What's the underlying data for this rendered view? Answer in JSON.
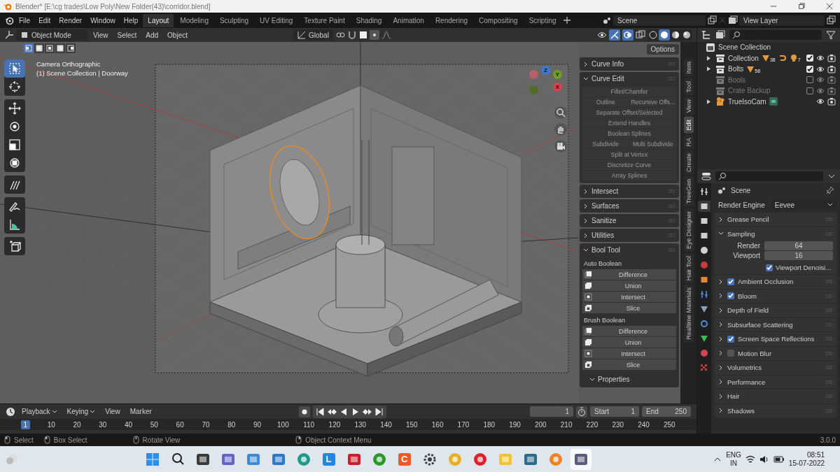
{
  "window": {
    "title": "Blender* [E:\\cg trades\\Low Poly\\New Folder(43)\\corridor.blend]"
  },
  "menu": [
    "File",
    "Edit",
    "Render",
    "Window",
    "Help"
  ],
  "workspaces": [
    {
      "label": "Layout",
      "selected": true
    },
    {
      "label": "Modeling",
      "selected": false
    },
    {
      "label": "Sculpting",
      "selected": false
    },
    {
      "label": "UV Editing",
      "selected": false
    },
    {
      "label": "Texture Paint",
      "selected": false
    },
    {
      "label": "Shading",
      "selected": false
    },
    {
      "label": "Animation",
      "selected": false
    },
    {
      "label": "Rendering",
      "selected": false
    },
    {
      "label": "Compositing",
      "selected": false
    },
    {
      "label": "Scripting",
      "selected": false
    }
  ],
  "scene": "Scene",
  "view_layer": "View Layer",
  "viewport_header": {
    "mode": "Object Mode",
    "menus": [
      "View",
      "Select",
      "Add",
      "Object"
    ],
    "orientation": "Global",
    "options": "Options",
    "shading": [
      {
        "kind": "wireframe",
        "selected": false
      },
      {
        "kind": "solid",
        "selected": true
      },
      {
        "kind": "material",
        "selected": false
      },
      {
        "kind": "rendered",
        "selected": false
      }
    ],
    "select_modes": [
      {
        "selected": true
      },
      {
        "selected": false
      },
      {
        "selected": false
      },
      {
        "selected": false
      },
      {
        "selected": false
      }
    ]
  },
  "overlay_text": [
    "Camera Orthographic",
    "(1) Scene Collection | Doorway"
  ],
  "gizmo": [
    {
      "label": "Y",
      "color": "#6e9f22",
      "kind": "y"
    },
    {
      "label": "Z",
      "color": "#3b78d0",
      "kind": "z"
    },
    {
      "label": "X",
      "color": "#d8434f",
      "kind": "x"
    }
  ],
  "tool_groups": [
    [
      {
        "kind": "select",
        "selected": true
      },
      {
        "kind": "cursor",
        "selected": false
      }
    ],
    [
      {
        "kind": "move",
        "selected": false
      },
      {
        "kind": "rotate",
        "selected": false
      },
      {
        "kind": "scale",
        "selected": false
      },
      {
        "kind": "transform",
        "selected": false
      }
    ],
    [
      {
        "kind": "annotate",
        "selected": false
      }
    ],
    [
      {
        "kind": "draw",
        "selected": false
      },
      {
        "kind": "measure",
        "selected": false
      }
    ],
    [
      {
        "kind": "add_cube",
        "selected": false
      }
    ]
  ],
  "sidebar_panels": [
    {
      "title": "Curve Info",
      "expanded": false
    },
    {
      "title": "Curve Edit",
      "expanded": true,
      "kind": "button_rows",
      "disabled": true,
      "rows": [
        [
          "Fillet/Chamfer"
        ],
        [
          "Outline",
          "Recursive Offs..."
        ],
        [
          "Separate Offset/Selected"
        ],
        [
          "Extend Handles"
        ],
        [
          "Boolean Splines"
        ],
        [
          "Subdivide",
          "Multi Subdivide"
        ],
        [
          "Split at Vertex"
        ],
        [
          "Discretize Curve"
        ],
        [
          "Array Splines"
        ]
      ]
    },
    {
      "title": "Intersect",
      "expanded": false
    },
    {
      "title": "Surfaces",
      "expanded": false
    },
    {
      "title": "Sanitize",
      "expanded": false
    },
    {
      "title": "Utilities",
      "expanded": false
    },
    {
      "title": "Bool Tool",
      "expanded": true,
      "kind": "bool_groups",
      "groups": [
        {
          "label": "Auto Boolean",
          "buttons": [
            {
              "label": "Difference",
              "kind": "difference"
            },
            {
              "label": "Union",
              "kind": "union"
            },
            {
              "label": "Intersect",
              "kind": "intersect"
            },
            {
              "label": "Slice",
              "kind": "slice"
            }
          ]
        },
        {
          "label": "Brush Boolean",
          "buttons": [
            {
              "label": "Difference",
              "kind": "difference"
            },
            {
              "label": "Union",
              "kind": "union"
            },
            {
              "label": "Intersect",
              "kind": "intersect"
            },
            {
              "label": "Slice",
              "kind": "slice"
            }
          ]
        }
      ],
      "subpanel": {
        "title": "Properties",
        "expanded": true
      }
    }
  ],
  "sidebar_tabs": [
    {
      "label": "Item",
      "selected": false
    },
    {
      "label": "Tool",
      "selected": false
    },
    {
      "label": "View",
      "selected": false
    },
    {
      "label": "Edit",
      "selected": true
    },
    {
      "label": "RA",
      "selected": false
    },
    {
      "label": "Create",
      "selected": false
    },
    {
      "label": "TreeGen",
      "selected": false
    },
    {
      "label": "Eye Designer",
      "selected": false
    },
    {
      "label": "Hair Tool",
      "selected": false
    },
    {
      "label": "Realtime Materials",
      "selected": false
    }
  ],
  "outliner": {
    "root": "Scene Collection",
    "items": [
      {
        "name": "Collection",
        "kind": "collection",
        "expandable": true,
        "checked": true,
        "badges": [
          {
            "kind": "mesh",
            "count": "38"
          },
          {
            "kind": "curve"
          },
          {
            "kind": "light",
            "count": "7"
          }
        ]
      },
      {
        "name": "Bolts",
        "kind": "collection",
        "expandable": true,
        "checked": true,
        "badges": [
          {
            "kind": "mesh",
            "count": "58"
          }
        ]
      },
      {
        "name": "Bools",
        "kind": "collection",
        "expandable": false,
        "checked": false
      },
      {
        "name": "Crate Backup",
        "kind": "collection",
        "expandable": false,
        "checked": false
      },
      {
        "name": "TrueIsoCam",
        "kind": "camera",
        "expandable": true,
        "badges": [
          {
            "kind": "camera_data"
          }
        ]
      }
    ]
  },
  "properties": {
    "title": "Scene",
    "render_engine_label": "Render Engine",
    "render_engine": "Eevee",
    "tabs": [
      {
        "kind": "tool",
        "selected": false
      },
      {
        "kind": "render",
        "selected": true
      },
      {
        "kind": "output",
        "selected": false
      },
      {
        "kind": "view_layer",
        "selected": false
      },
      {
        "kind": "scene",
        "selected": false
      },
      {
        "kind": "world",
        "selected": false
      },
      {
        "kind": "object",
        "selected": false
      },
      {
        "kind": "modifier",
        "selected": false
      },
      {
        "kind": "particles",
        "selected": false
      },
      {
        "kind": "physics",
        "selected": false
      },
      {
        "kind": "data",
        "selected": false
      },
      {
        "kind": "material",
        "selected": false
      },
      {
        "kind": "texture",
        "selected": false
      }
    ],
    "panels": [
      {
        "title": "Grease Pencil",
        "expanded": false
      },
      {
        "title": "Sampling",
        "expanded": true,
        "fields": [
          {
            "label": "Render",
            "value": "64"
          },
          {
            "label": "Viewport",
            "value": "16"
          }
        ],
        "option": {
          "label": "Viewport Denoisi...",
          "checked": true
        }
      },
      {
        "title": "Ambient Occlusion",
        "expanded": false,
        "checked": true
      },
      {
        "title": "Bloom",
        "expanded": false,
        "checked": true
      },
      {
        "title": "Depth of Field",
        "expanded": false
      },
      {
        "title": "Subsurface Scattering",
        "expanded": false
      },
      {
        "title": "Screen Space Reflections",
        "expanded": false,
        "checked": true
      },
      {
        "title": "Motion Blur",
        "expanded": false,
        "checked": false
      },
      {
        "title": "Volumetrics",
        "expanded": false
      },
      {
        "title": "Performance",
        "expanded": false
      },
      {
        "title": "Hair",
        "expanded": false
      },
      {
        "title": "Shadows",
        "expanded": false
      }
    ]
  },
  "timeline": {
    "menus": [
      {
        "label": "Playback",
        "dropdown": true
      },
      {
        "label": "Keying",
        "dropdown": true
      },
      {
        "label": "View",
        "dropdown": false
      },
      {
        "label": "Marker",
        "dropdown": false
      }
    ],
    "current_frame": "1",
    "start_label": "Start",
    "start": "1",
    "end_label": "End",
    "end": "250",
    "ruler": [
      {
        "label": "1",
        "selected": true
      },
      {
        "label": "10",
        "selected": false
      },
      {
        "label": "20",
        "selected": false
      },
      {
        "label": "30",
        "selected": false
      },
      {
        "label": "40",
        "selected": false
      },
      {
        "label": "50",
        "selected": false
      },
      {
        "label": "60",
        "selected": false
      },
      {
        "label": "70",
        "selected": false
      },
      {
        "label": "80",
        "selected": false
      },
      {
        "label": "90",
        "selected": false
      },
      {
        "label": "100",
        "selected": false
      },
      {
        "label": "110",
        "selected": false
      },
      {
        "label": "120",
        "selected": false
      },
      {
        "label": "130",
        "selected": false
      },
      {
        "label": "140",
        "selected": false
      },
      {
        "label": "150",
        "selected": false
      },
      {
        "label": "160",
        "selected": false
      },
      {
        "label": "170",
        "selected": false
      },
      {
        "label": "180",
        "selected": false
      },
      {
        "label": "190",
        "selected": false
      },
      {
        "label": "200",
        "selected": false
      },
      {
        "label": "210",
        "selected": false
      },
      {
        "label": "220",
        "selected": false
      },
      {
        "label": "230",
        "selected": false
      },
      {
        "label": "240",
        "selected": false
      },
      {
        "label": "250",
        "selected": false
      }
    ]
  },
  "status_bar": {
    "items": [
      {
        "kind": "left_click",
        "label": "Select"
      },
      {
        "kind": "drag",
        "label": "Box Select"
      },
      {
        "kind": "middle_click",
        "label": "Rotate View"
      },
      {
        "kind": "right_click",
        "label": "Object Context Menu"
      }
    ],
    "version": "3.0.0"
  },
  "taskbar": {
    "apps": [
      {
        "kind": "windows",
        "color": "#2f8fe6",
        "selected": false
      },
      {
        "kind": "search",
        "color": "#202020",
        "selected": false
      },
      {
        "kind": "tile",
        "color": "#3a3a3a",
        "selected": false
      },
      {
        "kind": "tile",
        "color": "#6264c8",
        "selected": false
      },
      {
        "kind": "tile",
        "color": "#3a8ad8",
        "selected": false
      },
      {
        "kind": "tile",
        "color": "#2a78d0",
        "selected": false
      },
      {
        "kind": "round",
        "color": "#1f9a8a",
        "selected": false
      },
      {
        "kind": "letter",
        "letter": "L",
        "color": "#1e88e5",
        "selected": false
      },
      {
        "kind": "tile",
        "color": "#c8202a",
        "selected": false
      },
      {
        "kind": "round",
        "color": "#2a9a2a",
        "selected": false
      },
      {
        "kind": "letter",
        "letter": "C",
        "color": "#f05a28",
        "selected": false
      },
      {
        "kind": "gear",
        "color": "#404040",
        "selected": false
      },
      {
        "kind": "round",
        "color": "#e8b020",
        "selected": false
      },
      {
        "kind": "round",
        "color": "#e0202a",
        "selected": false
      },
      {
        "kind": "tile",
        "color": "#f2c230",
        "selected": false
      },
      {
        "kind": "tile",
        "color": "#2a6a8a",
        "selected": false
      },
      {
        "kind": "round",
        "color": "#f08020",
        "selected": false
      },
      {
        "kind": "tile",
        "color": "#5a5a7a",
        "selected": true
      }
    ],
    "language": "ENG",
    "region": "IN",
    "time": "08:51",
    "date": "15-07-2022"
  }
}
